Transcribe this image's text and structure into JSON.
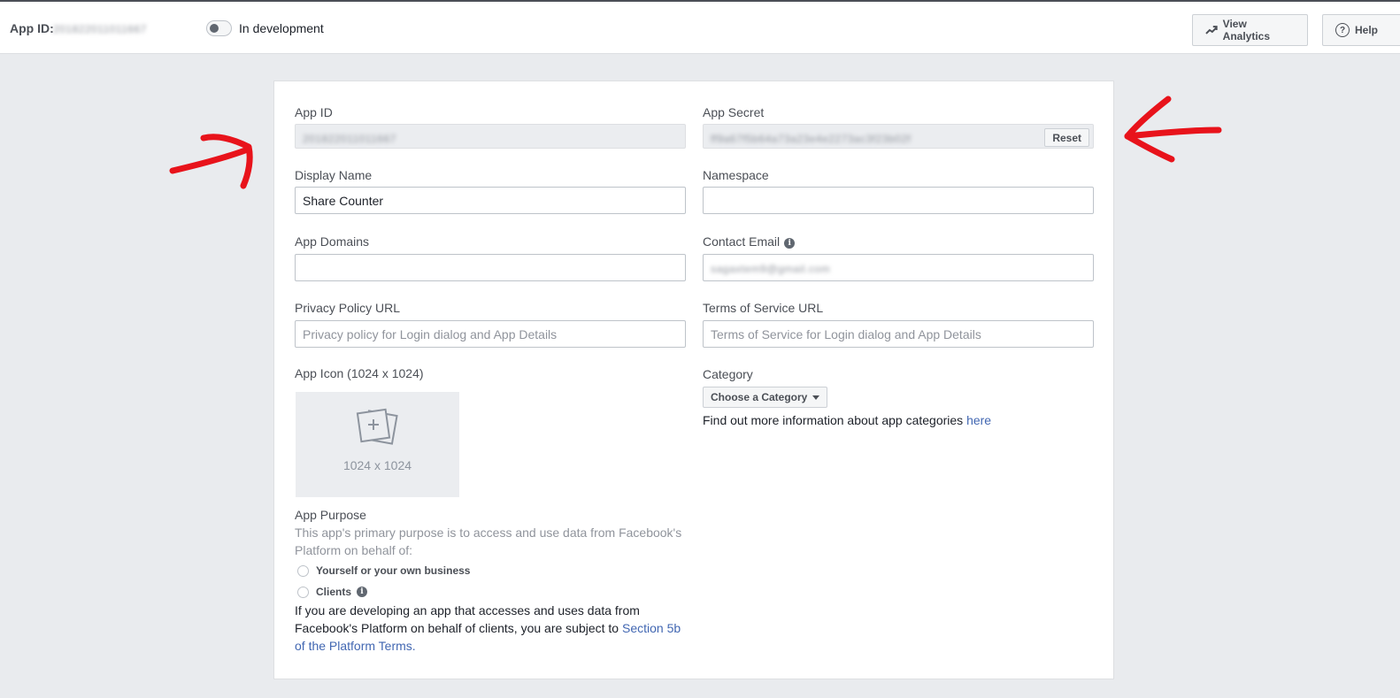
{
  "topbar": {
    "app_id_label": "App ID:",
    "app_id_value": "201822011011667",
    "dev_status": "In development",
    "analytics_label": "View Analytics",
    "help_label": "Help"
  },
  "form": {
    "app_id": {
      "label": "App ID",
      "value": "201822011011667"
    },
    "app_secret": {
      "label": "App Secret",
      "value": "ff9a67f5b64a73a23e4e2273ac3f23b02f",
      "reset_label": "Reset"
    },
    "display_name": {
      "label": "Display Name",
      "value": "Share Counter"
    },
    "namespace": {
      "label": "Namespace",
      "value": ""
    },
    "app_domains": {
      "label": "App Domains",
      "value": ""
    },
    "contact_email": {
      "label": "Contact Email",
      "value": "sagaxtem9@gmail.com"
    },
    "privacy_policy": {
      "label": "Privacy Policy URL",
      "placeholder": "Privacy policy for Login dialog and App Details"
    },
    "terms_of_service": {
      "label": "Terms of Service URL",
      "placeholder": "Terms of Service for Login dialog and App Details"
    },
    "app_icon": {
      "label": "App Icon (1024 x 1024)",
      "size_text": "1024 x 1024"
    },
    "category": {
      "label": "Category",
      "button_label": "Choose a Category",
      "help_text": "Find out more information about app categories",
      "help_link": "here"
    },
    "app_purpose": {
      "label": "App Purpose",
      "description": "This app's primary purpose is to access and use data from Facebook's Platform on behalf of:",
      "options": [
        "Yourself or your own business",
        "Clients"
      ],
      "notice": "If you are developing an app that accesses and uses data from Facebook's Platform on behalf of clients, you are subject to",
      "notice_link": "Section 5b of the Platform Terms",
      "notice_end": "."
    }
  },
  "colors": {
    "background": "#e9ebee",
    "link": "#4267b2",
    "annotation": "#e8131b"
  }
}
